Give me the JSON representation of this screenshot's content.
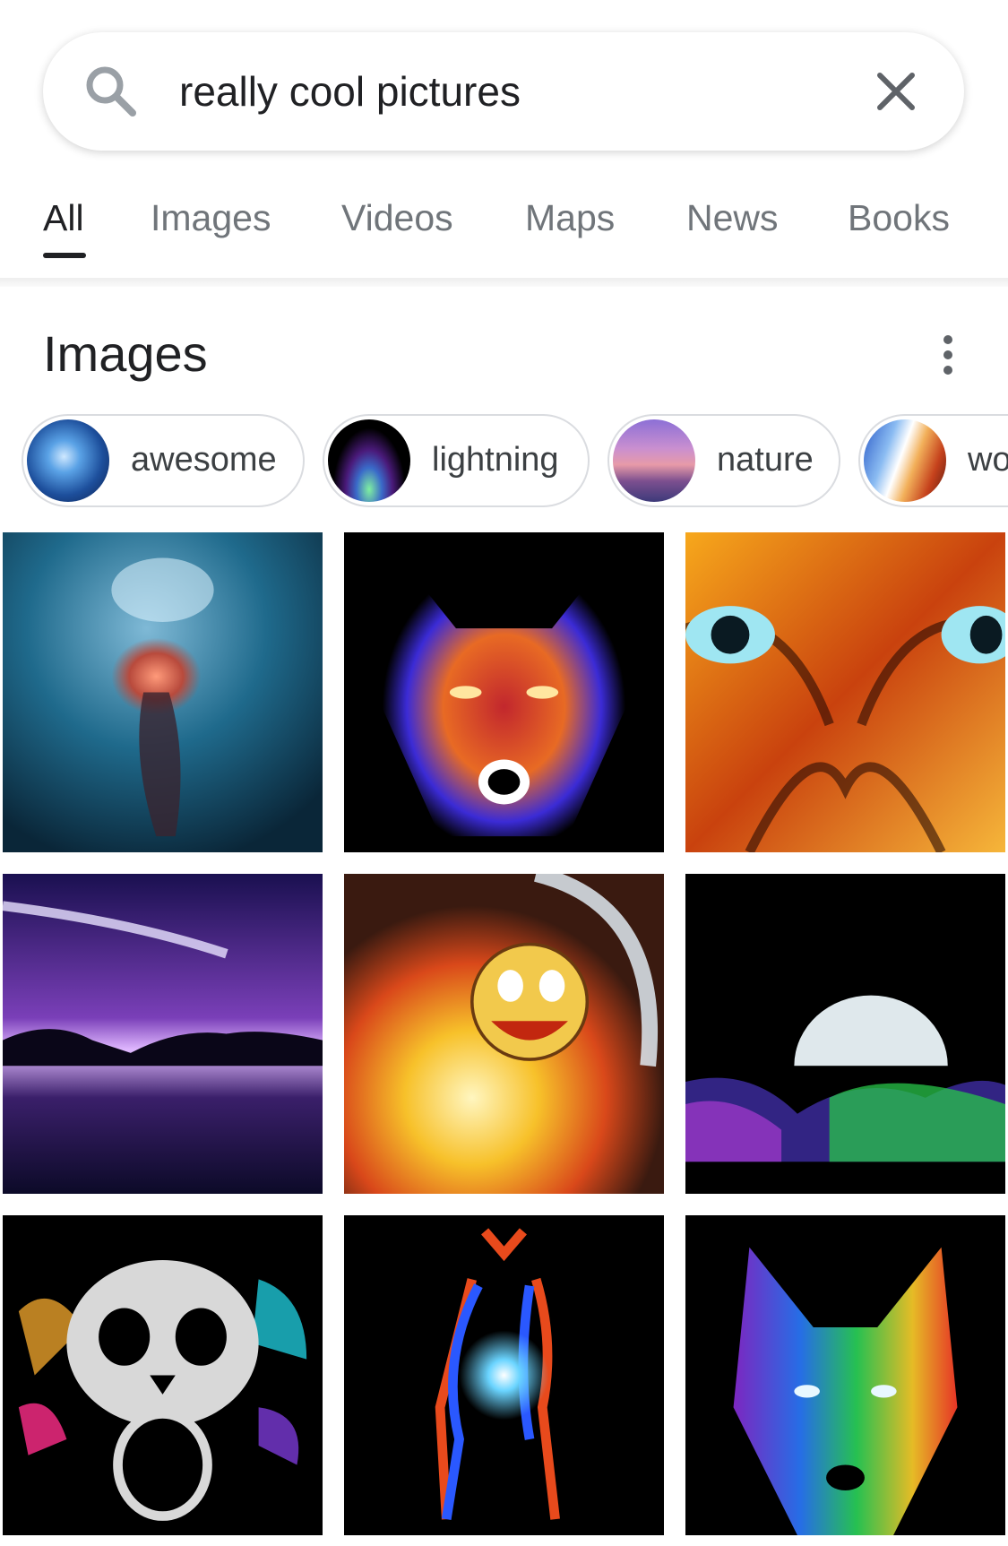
{
  "search": {
    "query": "really cool pictures",
    "icon": "search-icon",
    "clear_icon": "close-icon"
  },
  "tabs": [
    {
      "label": "All",
      "active": true
    },
    {
      "label": "Images",
      "active": false
    },
    {
      "label": "Videos",
      "active": false
    },
    {
      "label": "Maps",
      "active": false
    },
    {
      "label": "News",
      "active": false
    },
    {
      "label": "Books",
      "active": false
    }
  ],
  "images_section": {
    "title": "Images",
    "more_icon": "more-vert-icon"
  },
  "chips": [
    {
      "label": "awesome"
    },
    {
      "label": "lightning"
    },
    {
      "label": "nature"
    },
    {
      "label": "wo"
    }
  ],
  "image_results": [
    {
      "description": "blue cosmic figure"
    },
    {
      "description": "neon wolf"
    },
    {
      "description": "fire tiger face"
    },
    {
      "description": "purple galaxy over lake"
    },
    {
      "description": "flaming smiley meteor"
    },
    {
      "description": "moon over neon landscape"
    },
    {
      "description": "colorful skull"
    },
    {
      "description": "glowing airbender figure"
    },
    {
      "description": "rainbow wolf"
    }
  ],
  "colors": {
    "text_primary": "#202124",
    "text_secondary": "#70757a",
    "chip_border": "#dadce0"
  }
}
